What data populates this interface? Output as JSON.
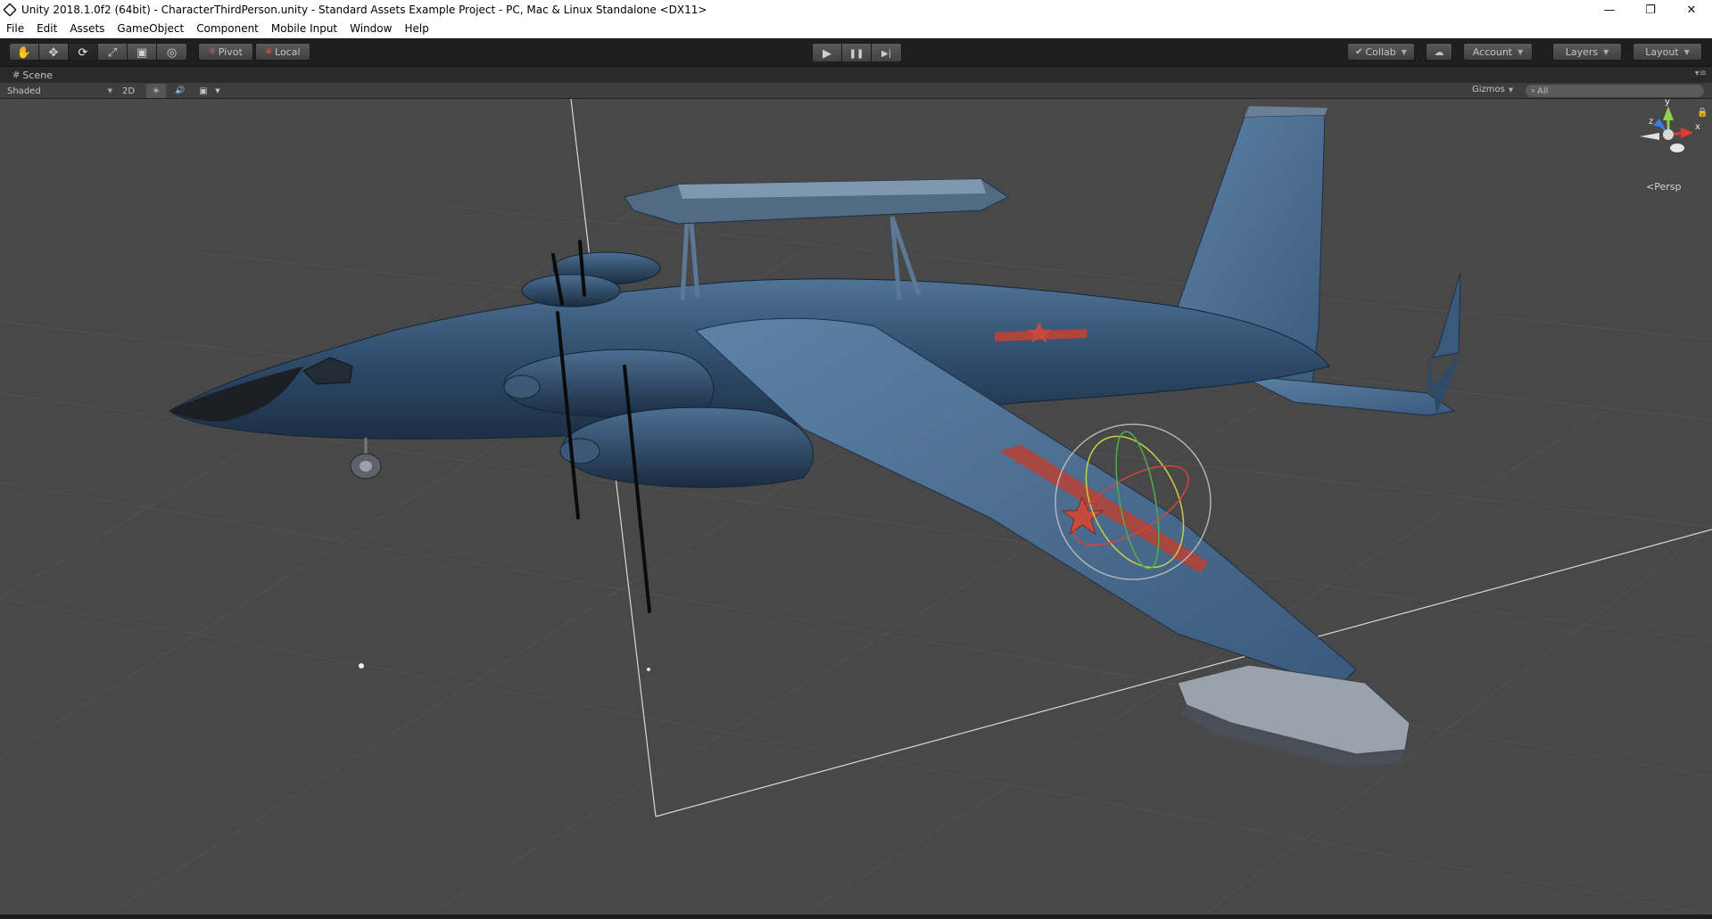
{
  "window": {
    "title": "Unity 2018.1.0f2 (64bit) - CharacterThirdPerson.unity - Standard Assets Example Project - PC, Mac & Linux Standalone <DX11>",
    "minimize_glyph": "—",
    "restore_glyph": "❐",
    "close_glyph": "✕"
  },
  "menu": {
    "items": [
      "File",
      "Edit",
      "Assets",
      "GameObject",
      "Component",
      "Mobile Input",
      "Window",
      "Help"
    ]
  },
  "toolbar": {
    "tools": [
      {
        "name": "hand-tool",
        "glyph": "✋"
      },
      {
        "name": "move-tool",
        "glyph": "✥"
      },
      {
        "name": "rotate-tool",
        "glyph": "⟳"
      },
      {
        "name": "scale-tool",
        "glyph": "⤢"
      },
      {
        "name": "rect-tool",
        "glyph": "▣"
      },
      {
        "name": "transform-tool",
        "glyph": "◎"
      }
    ],
    "active_tool": "rotate-tool",
    "pivot_label": "Pivot",
    "local_label": "Local",
    "play_glyph": "▶",
    "pause_glyph": "❚❚",
    "step_glyph": "▶|",
    "collab_label": "Collab",
    "cloud_glyph": "☁",
    "account_label": "Account",
    "layers_label": "Layers",
    "layout_label": "Layout"
  },
  "scene": {
    "tab_label": "Scene",
    "tab_menu_glyph": "▾≡",
    "shading_mode": "Shaded",
    "mode_2d_label": "2D",
    "light_glyph": "☀",
    "audio_glyph": "🔊",
    "fx_glyph": "▣",
    "gizmos_label": "Gizmos",
    "search_placeholder": "All",
    "search_glyph": "⌕",
    "projection_label": "Persp",
    "axis_x": "x",
    "axis_y": "y",
    "axis_z": "z"
  },
  "colors": {
    "editor_bg": "#3b3b3b",
    "toolbar_bg": "#1f1f1f",
    "viewport_bg": "#484848",
    "aircraft_body": "#2f4c6b",
    "roundel_red": "#b3443a",
    "axis_x": "#e03a2f",
    "axis_y": "#8fd14f",
    "axis_z": "#3a7de0"
  }
}
